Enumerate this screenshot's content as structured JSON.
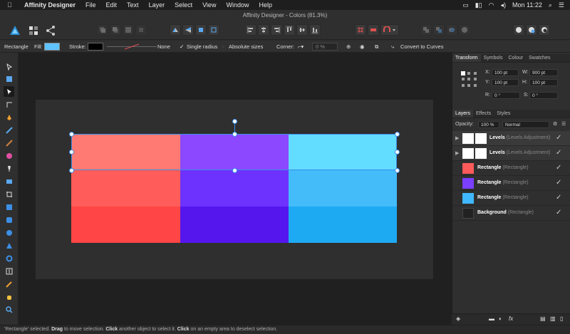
{
  "menubar": {
    "app_name": "Affinity Designer",
    "items": [
      "File",
      "Edit",
      "Text",
      "Layer",
      "Select",
      "View",
      "Window",
      "Help"
    ],
    "clock": "Mon 11:22"
  },
  "window": {
    "title": "Affinity Designer - Colors (81.3%)"
  },
  "context": {
    "shape_label": "Rectangle",
    "fill_label": "Fill:",
    "fill_color": "#5ec3ff",
    "stroke_label": "Stroke:",
    "stroke_value": "None",
    "single_radius": "Single radius",
    "absolute_sizes": "Absolute sizes",
    "corner_label": "Corner:",
    "corner_value": "0 %",
    "convert_label": "Convert to Curves"
  },
  "transform": {
    "tabs": [
      "Transform",
      "Symbols",
      "Colour",
      "Swatches"
    ],
    "x_label": "X:",
    "x": "100 pt",
    "y_label": "Y:",
    "y": "100 pt",
    "w_label": "W:",
    "w": "900 pt",
    "h_label": "H:",
    "h": "100 pt",
    "r_label": "R:",
    "r": "0 °",
    "s_label": "S:",
    "s": "0 °"
  },
  "layers_panel": {
    "tabs": [
      "Layers",
      "Effects",
      "Styles"
    ],
    "opacity_label": "Opacity:",
    "opacity": "100 %",
    "blend": "Normal",
    "layers": [
      {
        "name": "Levels",
        "type": "(Levels Adjustment)"
      },
      {
        "name": "Levels",
        "type": "(Levels Adjustment)"
      },
      {
        "name": "Rectangle",
        "type": "(Rectangle)",
        "color": "#ff5a5a"
      },
      {
        "name": "Rectangle",
        "type": "(Rectangle)",
        "color": "#7b3fff"
      },
      {
        "name": "Rectangle",
        "type": "(Rectangle)",
        "color": "#3fb8ff"
      },
      {
        "name": "Background",
        "type": "(Rectangle)",
        "color": "#2a2a2a"
      }
    ]
  },
  "canvas": {
    "colors": {
      "row1": [
        "#ff7a72",
        "#8b48ff",
        "#62ddff"
      ],
      "row2": [
        "#ff5c5a",
        "#6e32ff",
        "#44bcfa"
      ],
      "row3": [
        "#ff4545",
        "#5516ee",
        "#1eaaf3"
      ]
    }
  },
  "status": {
    "p1": "'Rectangle' selected. ",
    "drag": "Drag",
    "p2": " to move selection. ",
    "click": "Click",
    "p3": " another object to select it. ",
    "click2": "Click",
    "p4": " on an empty area to deselect selection."
  }
}
